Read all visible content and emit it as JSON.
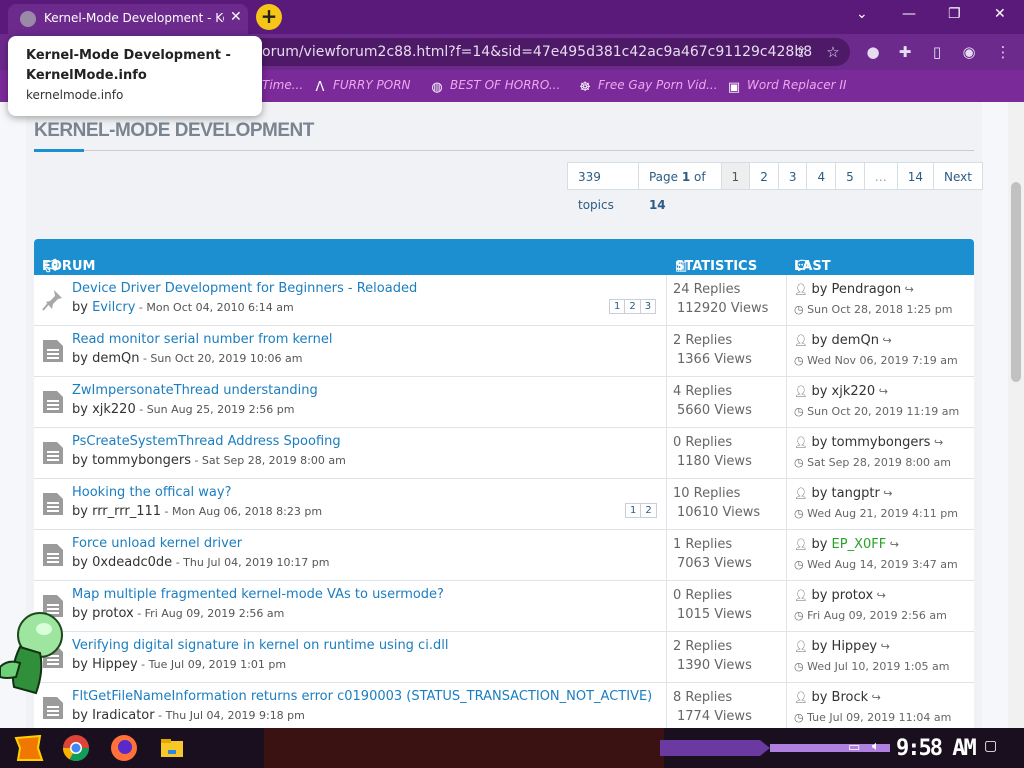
{
  "browser": {
    "tab_title": "Kernel-Mode Development - KernelMode.info",
    "url": "orum/viewforum2c88.html?f=14&sid=47e495d381c42ac9a467c91129c428b8",
    "tooltip": {
      "title": "Kernel-Mode Development - KernelMode.info",
      "domain": "kernelmode.info"
    },
    "bookmarks": [
      {
        "label": "Time...",
        "icon": "bookmark-icon"
      },
      {
        "label": "FURRY PORN",
        "icon": "lambda-icon"
      },
      {
        "label": "BEST OF HORRO...",
        "icon": "globe-icon"
      },
      {
        "label": "Free Gay Porn Vid...",
        "icon": "bookmark-icon"
      },
      {
        "label": "Word Replacer II",
        "icon": "wr-icon"
      }
    ]
  },
  "page": {
    "heading": "KERNEL-MODE DEVELOPMENT",
    "pagination": {
      "topics": "339 topics",
      "page_label": "Page ",
      "page_current": "1",
      "page_of": " of ",
      "page_total": "14",
      "pages": [
        "1",
        "2",
        "3",
        "4",
        "5",
        "…",
        "14"
      ],
      "next": "Next"
    },
    "columns": {
      "forum": "FORUM",
      "statistics": "STATISTICS",
      "last_post": "LAST POST"
    },
    "topics": [
      {
        "title": "Device Driver Development for Beginners - Reloaded",
        "author": "Evilcry",
        "date": "- Mon Oct 04, 2010 6:14 am",
        "replies": "24 Replies",
        "views": "112920 Views",
        "last_user": "Pendragon",
        "last_date": "Sun Oct 28, 2018 1:25 pm",
        "pages": [
          "1",
          "2",
          "3"
        ],
        "sticky": true
      },
      {
        "title": "Read monitor serial number from kernel",
        "author": "demQn",
        "date": "- Sun Oct 20, 2019 10:06 am",
        "replies": "2 Replies",
        "views": "1366 Views",
        "last_user": "demQn",
        "last_date": "Wed Nov 06, 2019 7:19 am"
      },
      {
        "title": "ZwImpersonateThread understanding",
        "author": "xjk220",
        "date": "- Sun Aug 25, 2019 2:56 pm",
        "replies": "4 Replies",
        "views": "5660 Views",
        "last_user": "xjk220",
        "last_date": "Sun Oct 20, 2019 11:19 am"
      },
      {
        "title": "PsCreateSystemThread Address Spoofing",
        "author": "tommybongers",
        "date": "- Sat Sep 28, 2019 8:00 am",
        "replies": "0 Replies",
        "views": "1180 Views",
        "last_user": "tommybongers",
        "last_date": "Sat Sep 28, 2019 8:00 am"
      },
      {
        "title": "Hooking the offical way?",
        "author": "rrr_rrr_111",
        "date": "- Mon Aug 06, 2018 8:23 pm",
        "replies": "10 Replies",
        "views": "10610 Views",
        "last_user": "tangptr",
        "last_date": "Wed Aug 21, 2019 4:11 pm",
        "pages": [
          "1",
          "2"
        ]
      },
      {
        "title": "Force unload kernel driver",
        "author": "0xdeadc0de",
        "date": "- Thu Jul 04, 2019 10:17 pm",
        "replies": "1 Replies",
        "views": "7063 Views",
        "last_user": "EP_X0FF",
        "last_date": "Wed Aug 14, 2019 3:47 am",
        "last_user_green": true
      },
      {
        "title": "Map multiple fragmented kernel-mode VAs to usermode?",
        "author": "protox",
        "date": "- Fri Aug 09, 2019 2:56 am",
        "replies": "0 Replies",
        "views": "1015 Views",
        "last_user": "protox",
        "last_date": "Fri Aug 09, 2019 2:56 am"
      },
      {
        "title": "Verifying digital signature in kernel on runtime using ci.dll",
        "author": "Hippey",
        "date": "- Tue Jul 09, 2019 1:01 pm",
        "replies": "2 Replies",
        "views": "1390 Views",
        "last_user": "Hippey",
        "last_date": "Wed Jul 10, 2019 1:05 am"
      },
      {
        "title": "FltGetFileNameInformation returns error c0190003 (STATUS_TRANSACTION_NOT_ACTIVE)",
        "author": "Iradicator",
        "date": "- Thu Jul 04, 2019 9:18 pm",
        "replies": "8 Replies",
        "views": "1774 Views",
        "last_user": "Brock",
        "last_date": "Tue Jul 09, 2019 11:04 am"
      }
    ],
    "by_label": "by "
  },
  "taskbar": {
    "clock": "9:58 AM"
  },
  "colors": {
    "accent": "#1b8fd0",
    "link": "#1b7ec0",
    "chrome": "#6b2a8c",
    "bookmark_text": "#f0a7f0"
  }
}
